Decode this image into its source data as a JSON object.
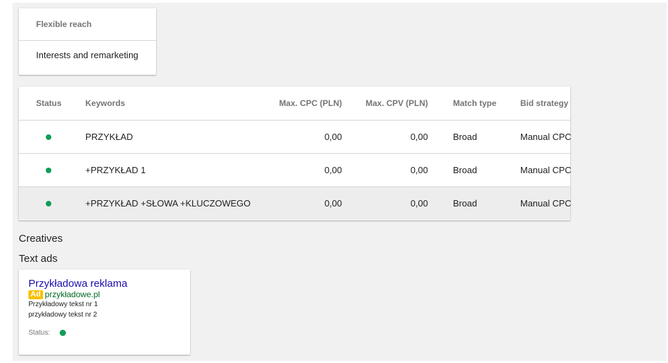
{
  "flexible_reach": {
    "header": "Flexible reach",
    "value": "Interests and remarketing"
  },
  "keywords_table": {
    "columns": {
      "status": "Status",
      "keywords": "Keywords",
      "max_cpc": "Max. CPC (PLN)",
      "max_cpv": "Max. CPV (PLN)",
      "match_type": "Match type",
      "bid_strategy": "Bid strategy"
    },
    "rows": [
      {
        "keyword": "PRZYKŁAD",
        "max_cpc": "0,00",
        "max_cpv": "0,00",
        "match_type": "Broad",
        "bid_strategy": "Manual CPC"
      },
      {
        "keyword": "+PRZYKŁAD 1",
        "max_cpc": "0,00",
        "max_cpv": "0,00",
        "match_type": "Broad",
        "bid_strategy": "Manual CPC"
      },
      {
        "keyword": "+PRZYKŁAD +SŁOWA +KLUCZOWEGO",
        "max_cpc": "0,00",
        "max_cpv": "0,00",
        "match_type": "Broad",
        "bid_strategy": "Manual CPC"
      }
    ]
  },
  "creatives": {
    "heading": "Creatives",
    "subheading": "Text ads"
  },
  "ad": {
    "title": "Przykładowa reklama",
    "badge": "Ad",
    "url": "przykładowe.pl",
    "line1": "Przykładowy tekst nr 1",
    "line2": "przykładowy tekst nr 2",
    "status_label": "Status:"
  },
  "colors": {
    "status_active": "#0f9d58",
    "link": "#1a0dab",
    "url": "#006621",
    "badge": "#f9c000"
  }
}
